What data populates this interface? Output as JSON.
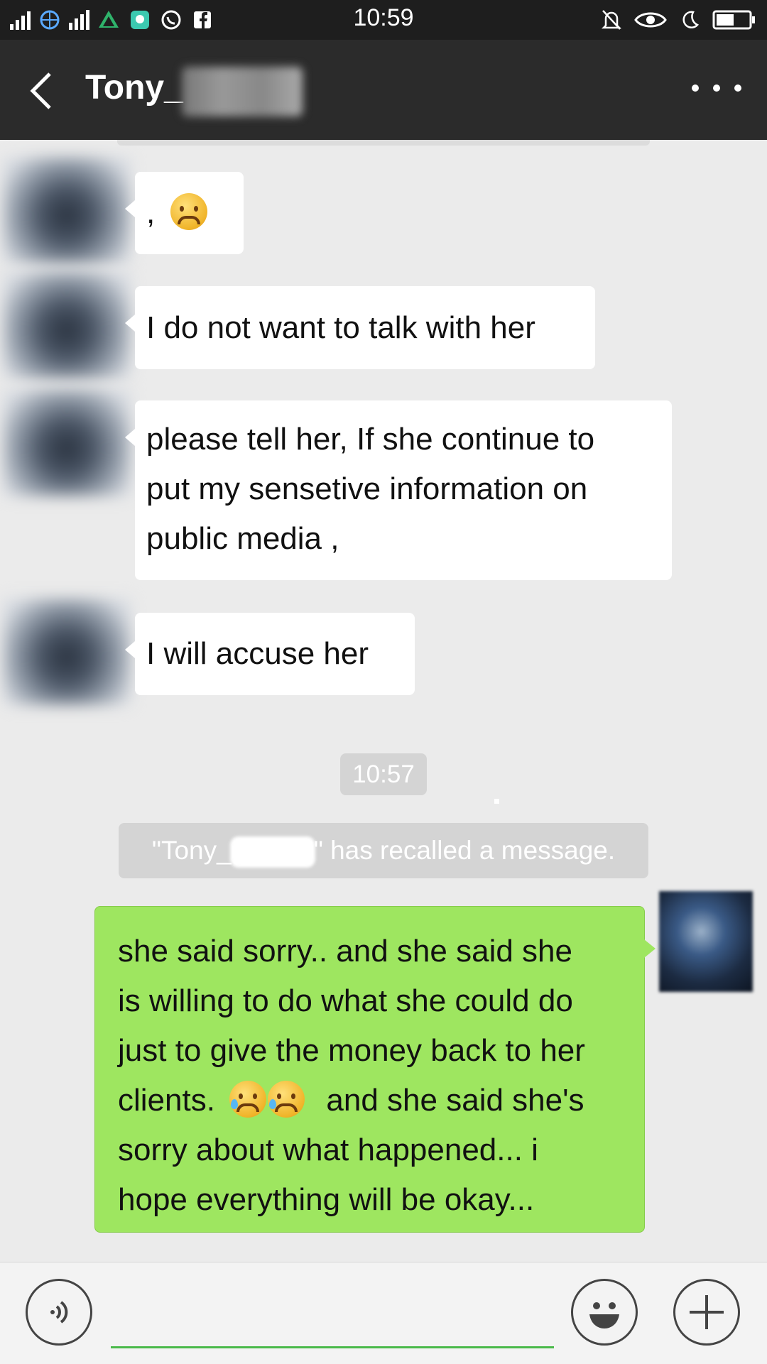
{
  "status_bar": {
    "time": "10:59"
  },
  "header": {
    "title": "Tony_"
  },
  "messages": [
    {
      "side": "incoming",
      "text": ","
    },
    {
      "side": "incoming",
      "text": "I do not want to talk with her"
    },
    {
      "side": "incoming",
      "lines": [
        " please tell her, If she continue to",
        "put my sensetive information on",
        "public media ,"
      ]
    },
    {
      "side": "incoming",
      "text": "I will accuse her"
    }
  ],
  "timestamp": "10:57",
  "system_notice": {
    "prefix": "\"Tony_",
    "suffix": "\" has recalled a message."
  },
  "outgoing": {
    "lines": [
      "she said sorry.. and she said she",
      "is willing to do what she could do",
      "just to give the money back to her",
      "clients.",
      "and she said she's",
      "sorry about what happened... i",
      "hope everything will be okay..."
    ]
  },
  "colors": {
    "accent": "#9ee660",
    "header_bg": "#2b2b2b",
    "input_underline": "#49b949"
  },
  "icons": [
    "back-arrow-icon",
    "more-icon",
    "voice-icon",
    "emoji-icon",
    "plus-icon"
  ]
}
